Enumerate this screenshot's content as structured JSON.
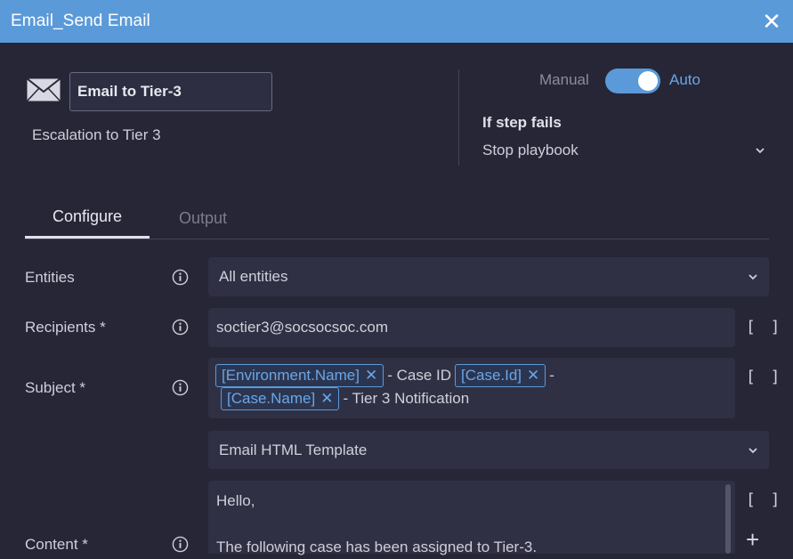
{
  "window": {
    "title": "Email_Send Email"
  },
  "step": {
    "name_value": "Email to Tier-3",
    "description": "Escalation to Tier 3"
  },
  "mode": {
    "manual_label": "Manual",
    "auto_label": "Auto",
    "state": "Auto"
  },
  "failure": {
    "label": "If step fails",
    "value": "Stop playbook"
  },
  "tabs": [
    {
      "label": "Configure",
      "active": true
    },
    {
      "label": "Output",
      "active": false
    }
  ],
  "form": {
    "entities": {
      "label": "Entities",
      "value": "All entities"
    },
    "recipients": {
      "label": "Recipients *",
      "value": "soctier3@socsocsoc.com"
    },
    "subject": {
      "label": "Subject *",
      "parts": [
        {
          "type": "chip",
          "text": "[Environment.Name]"
        },
        {
          "type": "text",
          "text": "- Case ID"
        },
        {
          "type": "chip",
          "text": "[Case.Id]"
        },
        {
          "type": "text",
          "text": "-"
        },
        {
          "type": "chip",
          "text": "[Case.Name]"
        },
        {
          "type": "text",
          "text": "- Tier 3 Notification"
        }
      ]
    },
    "template": {
      "value": "Email HTML Template"
    },
    "content": {
      "label": "Content *",
      "lines": [
        "Hello,",
        "",
        "The following case has been assigned to Tier-3."
      ]
    },
    "bracket_label": "[ ]",
    "plus_label": "+"
  },
  "icons": {
    "close": "close-icon",
    "envelope": "envelope-icon",
    "info": "info-icon",
    "chevron": "chevron-down-icon"
  },
  "colors": {
    "header": "#5b9ad8",
    "background": "#262637",
    "accent": "#6aa6e6"
  }
}
